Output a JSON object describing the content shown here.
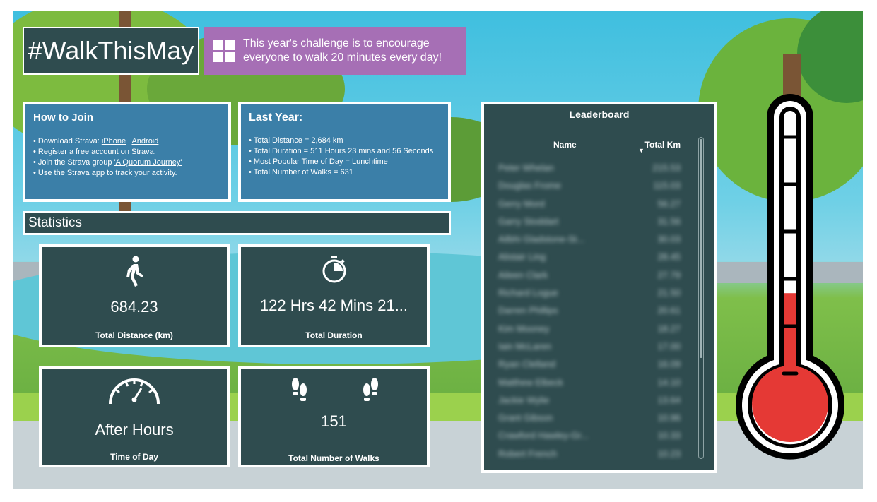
{
  "header": {
    "title": "#WalkThisMay",
    "banner_line1": "This year's challenge is to encourage",
    "banner_line2": "everyone to walk 20 minutes every day!",
    "banner_icon": "windows-icon"
  },
  "how_to_join": {
    "title": "How to Join",
    "item1_prefix": "Download Strava: ",
    "item1_link1": "iPhone",
    "item1_sep": " | ",
    "item1_link2": "Android",
    "item2_prefix": "Register a free account on ",
    "item2_link": "Strava",
    "item2_suffix": ".",
    "item3_prefix": "Join the Strava group ",
    "item3_link": "'A Quorum Journey'",
    "item4": "Use the Strava app to track your activity."
  },
  "last_year": {
    "title": "Last Year:",
    "items": [
      "Total Distance = 2,684 km",
      "Total Duration = 511 Hours 23 mins and 56 Seconds",
      "Most Popular Time of Day = Lunchtime",
      "Total Number of Walks = 631"
    ]
  },
  "statistics": {
    "title": "Statistics",
    "distance": {
      "value": "684.23",
      "label": "Total Distance (km)",
      "icon": "walking-person-icon"
    },
    "duration": {
      "value": "122 Hrs 42 Mins 21...",
      "label": "Total Duration",
      "icon": "stopwatch-icon"
    },
    "time_of_day": {
      "value": "After Hours",
      "label": "Time of Day",
      "icon": "speedometer-icon"
    },
    "walks": {
      "value": "151",
      "label": "Total Number of Walks",
      "icon": "footprints-icon"
    }
  },
  "leaderboard": {
    "title": "Leaderboard",
    "col_name": "Name",
    "col_km": "Total Km",
    "rows": [
      {
        "name": "Peter Whelan",
        "km": "215.53"
      },
      {
        "name": "Douglas Frome",
        "km": "115.03"
      },
      {
        "name": "Gerry Mord",
        "km": "56.27"
      },
      {
        "name": "Garry Stoddart",
        "km": "31.56"
      },
      {
        "name": "Ailbhi Gladstone-St...",
        "km": "30.03"
      },
      {
        "name": "Alistair Ling",
        "km": "28.45"
      },
      {
        "name": "Aileen Clark",
        "km": "27.79"
      },
      {
        "name": "Richard Logue",
        "km": "21.50"
      },
      {
        "name": "Darren Phillips",
        "km": "20.61"
      },
      {
        "name": "Kim Mooney",
        "km": "18.27"
      },
      {
        "name": "Iain McLaren",
        "km": "17.00"
      },
      {
        "name": "Ryan Clelland",
        "km": "16.09"
      },
      {
        "name": "Matthew Elbeck",
        "km": "14.10"
      },
      {
        "name": "Jackie Wylie",
        "km": "13.64"
      },
      {
        "name": "Grant Gibson",
        "km": "10.96"
      },
      {
        "name": "Crawford Hawley-Gr...",
        "km": "10.33"
      },
      {
        "name": "Robert French",
        "km": "10.23"
      }
    ]
  },
  "thermometer": {
    "fill_fraction": 0.3,
    "fill_color": "#e53935",
    "tick_count": 6
  }
}
